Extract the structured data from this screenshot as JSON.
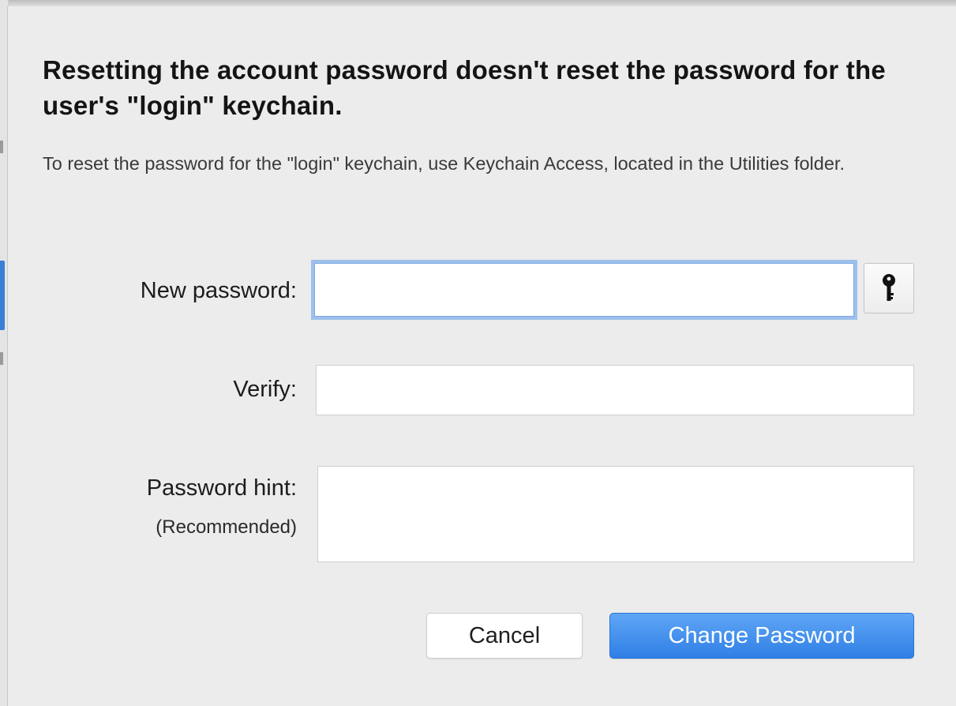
{
  "dialog": {
    "heading": "Resetting the account password doesn't reset the password for the user's \"login\" keychain.",
    "message": "To reset the password for the \"login\" keychain, use Keychain Access, located in the Utilities folder."
  },
  "form": {
    "new_password": {
      "label": "New password:",
      "value": ""
    },
    "verify": {
      "label": "Verify:",
      "value": ""
    },
    "hint": {
      "label": "Password hint:",
      "sublabel": "(Recommended)",
      "value": ""
    }
  },
  "buttons": {
    "cancel_label": "Cancel",
    "change_password_label": "Change Password"
  },
  "icons": {
    "password_assistant": "key-icon"
  },
  "colors": {
    "accent": "#2f7fe6",
    "focus_ring": "#9ec0ec",
    "background": "#ececec"
  }
}
